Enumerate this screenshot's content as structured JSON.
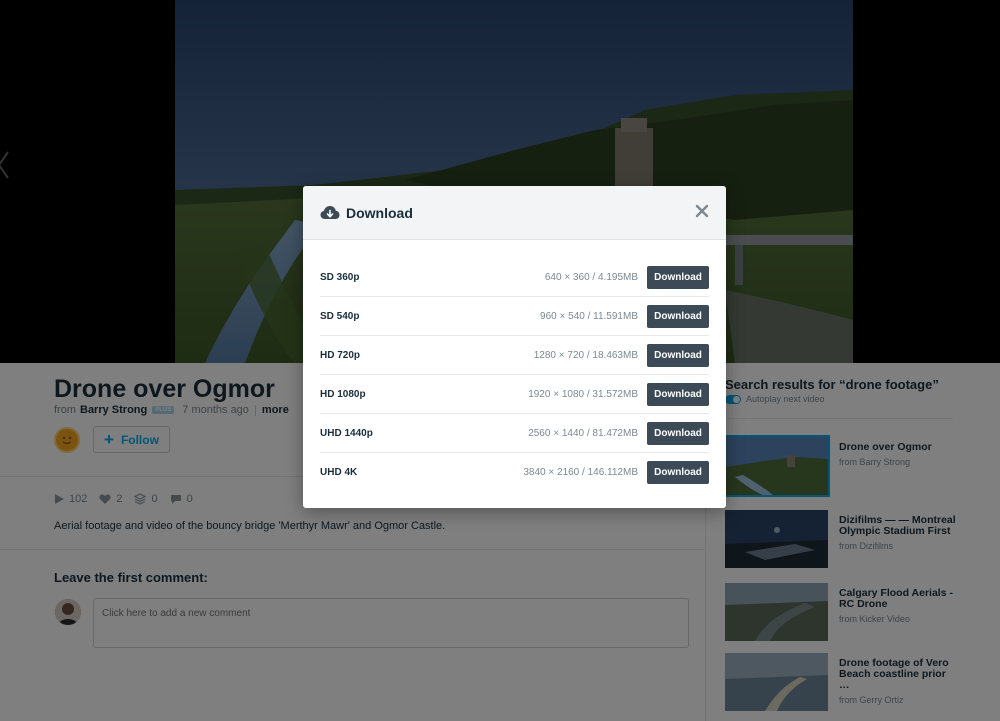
{
  "video": {
    "title": "Drone over Ogmor",
    "from_label": "from",
    "author": "Barry Strong",
    "plus_badge": "PLUS",
    "time_ago": "7 months ago",
    "more_label": "more",
    "follow_label": "Follow",
    "stats": {
      "plays": "102",
      "likes": "2",
      "collections": "0",
      "comments": "0"
    },
    "description": "Aerial footage and video of the bouncy bridge 'Merthyr Mawr' and Ogmor Castle."
  },
  "comments": {
    "heading": "Leave the first comment:",
    "placeholder": "Click here to add a new comment"
  },
  "sidebar": {
    "search_title": "Search results for “drone footage”",
    "autoplay_label": "Autoplay next video",
    "results": [
      {
        "title": "Drone over Ogmor",
        "from": "from Barry Strong"
      },
      {
        "title": "Dizifilms — — Montreal Olympic Stadium First",
        "from": "from Dizifilms"
      },
      {
        "title": "Calgary Flood Aerials - RC Drone",
        "from": "from Kicker Video"
      },
      {
        "title": "Drone footage of Vero Beach coastline prior …",
        "from": "from Gerry Ortiz"
      }
    ]
  },
  "modal": {
    "title": "Download",
    "button_label": "Download",
    "options": [
      {
        "quality": "SD 360p",
        "size": "640 × 360 / 4.195MB"
      },
      {
        "quality": "SD 540p",
        "size": "960 × 540 / 11.591MB"
      },
      {
        "quality": "HD 720p",
        "size": "1280 × 720 / 18.463MB"
      },
      {
        "quality": "HD 1080p",
        "size": "1920 × 1080 / 31.572MB"
      },
      {
        "quality": "UHD 1440p",
        "size": "2560 × 1440 / 81.472MB"
      },
      {
        "quality": "UHD 4K",
        "size": "3840 × 2160 / 146.112MB"
      }
    ]
  },
  "colors": {
    "accent": "#00adef",
    "download_button": "#3b4a56",
    "text_dark": "#1a2e3b",
    "text_muted": "#7d8890"
  },
  "icons": [
    "cloud-download-icon",
    "close-icon",
    "play-icon",
    "heart-icon",
    "stack-icon",
    "speech-bubble-icon",
    "plus-icon",
    "chevron-left-icon"
  ]
}
